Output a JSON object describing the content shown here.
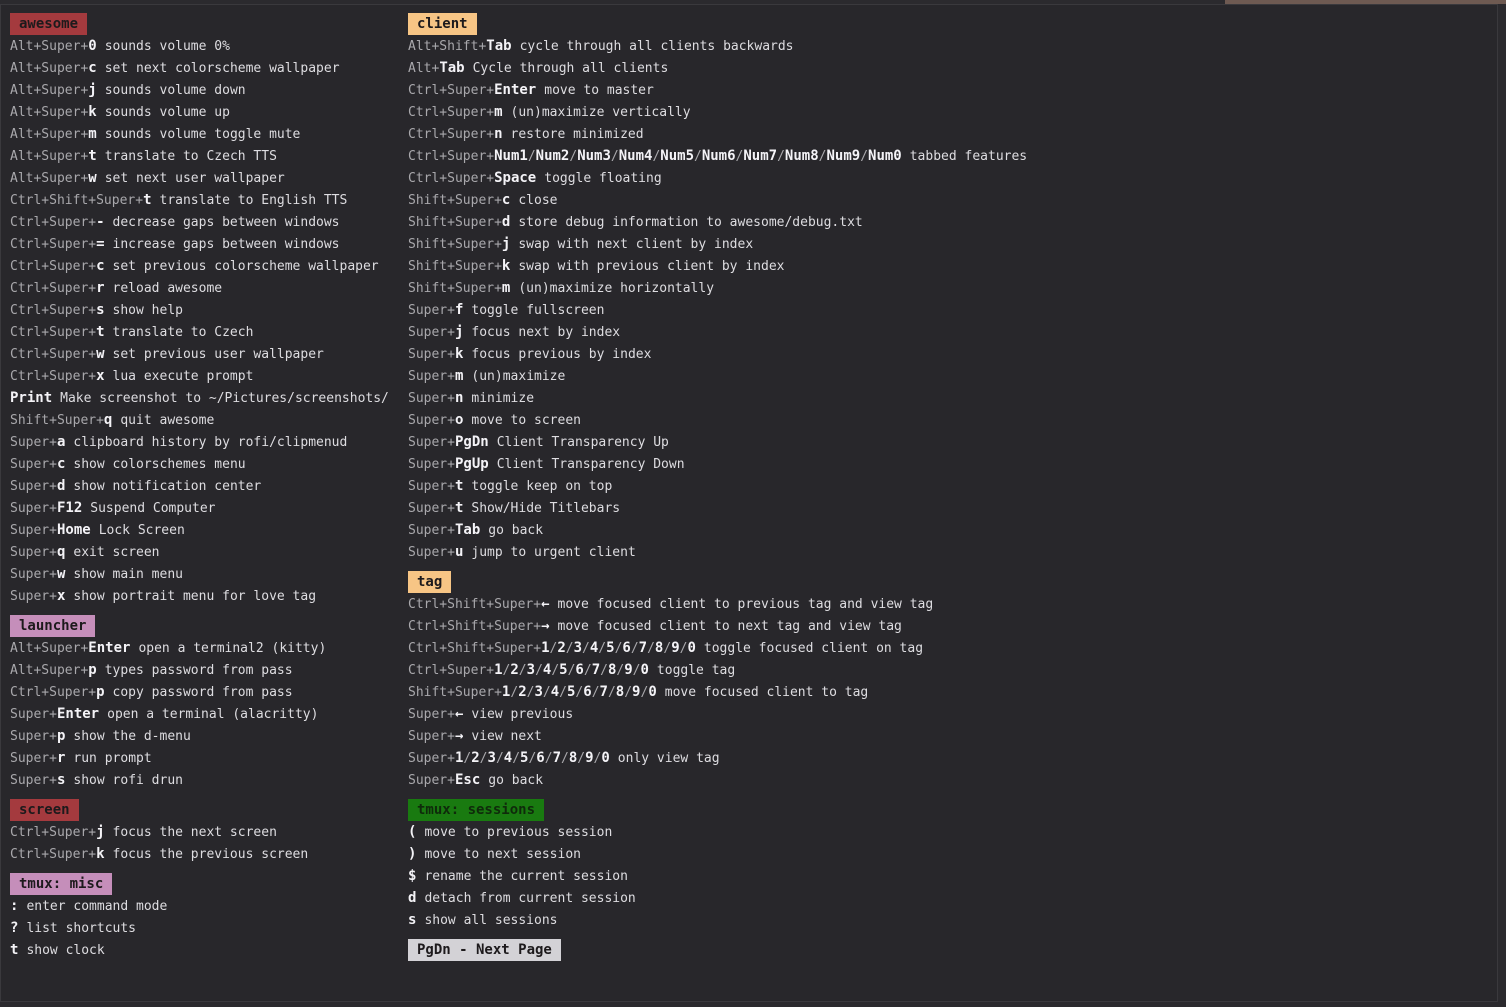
{
  "groups_left": [
    {
      "name": "awesome",
      "color": "red",
      "bindings": [
        {
          "mods": "Alt+Super+",
          "key": "0",
          "desc": "sounds volume 0%"
        },
        {
          "mods": "Alt+Super+",
          "key": "c",
          "desc": "set next colorscheme wallpaper"
        },
        {
          "mods": "Alt+Super+",
          "key": "j",
          "desc": "sounds volume down"
        },
        {
          "mods": "Alt+Super+",
          "key": "k",
          "desc": "sounds volume up"
        },
        {
          "mods": "Alt+Super+",
          "key": "m",
          "desc": "sounds volume toggle mute"
        },
        {
          "mods": "Alt+Super+",
          "key": "t",
          "desc": "translate to Czech TTS"
        },
        {
          "mods": "Alt+Super+",
          "key": "w",
          "desc": "set next user wallpaper"
        },
        {
          "mods": "Ctrl+Shift+Super+",
          "key": "t",
          "desc": "translate to English TTS"
        },
        {
          "mods": "Ctrl+Super+",
          "key": "-",
          "desc": "decrease gaps between windows"
        },
        {
          "mods": "Ctrl+Super+",
          "key": "=",
          "desc": "increase gaps between windows"
        },
        {
          "mods": "Ctrl+Super+",
          "key": "c",
          "desc": "set previous colorscheme wallpaper"
        },
        {
          "mods": "Ctrl+Super+",
          "key": "r",
          "desc": "reload awesome"
        },
        {
          "mods": "Ctrl+Super+",
          "key": "s",
          "desc": "show help"
        },
        {
          "mods": "Ctrl+Super+",
          "key": "t",
          "desc": "translate to Czech"
        },
        {
          "mods": "Ctrl+Super+",
          "key": "w",
          "desc": "set previous user wallpaper"
        },
        {
          "mods": "Ctrl+Super+",
          "key": "x",
          "desc": "lua execute prompt"
        },
        {
          "mods": "",
          "key": "Print",
          "desc": "Make screenshot to ~/Pictures/screenshots/"
        },
        {
          "mods": "Shift+Super+",
          "key": "q",
          "desc": "quit awesome"
        },
        {
          "mods": "Super+",
          "key": "a",
          "desc": "clipboard history by rofi/clipmenud"
        },
        {
          "mods": "Super+",
          "key": "c",
          "desc": "show colorschemes menu"
        },
        {
          "mods": "Super+",
          "key": "d",
          "desc": "show notification center"
        },
        {
          "mods": "Super+",
          "key": "F12",
          "desc": "Suspend Computer"
        },
        {
          "mods": "Super+",
          "key": "Home",
          "desc": "Lock Screen"
        },
        {
          "mods": "Super+",
          "key": "q",
          "desc": "exit screen"
        },
        {
          "mods": "Super+",
          "key": "w",
          "desc": "show main menu"
        },
        {
          "mods": "Super+",
          "key": "x",
          "desc": "show portrait menu for love tag"
        }
      ]
    },
    {
      "name": "launcher",
      "color": "pink",
      "bindings": [
        {
          "mods": "Alt+Super+",
          "key": "Enter",
          "desc": "open a terminal2 (kitty)"
        },
        {
          "mods": "Alt+Super+",
          "key": "p",
          "desc": "types password from pass"
        },
        {
          "mods": "Ctrl+Super+",
          "key": "p",
          "desc": "copy password from pass"
        },
        {
          "mods": "Super+",
          "key": "Enter",
          "desc": "open a terminal (alacritty)"
        },
        {
          "mods": "Super+",
          "key": "p",
          "desc": "show the d-menu"
        },
        {
          "mods": "Super+",
          "key": "r",
          "desc": "run prompt"
        },
        {
          "mods": "Super+",
          "key": "s",
          "desc": "show rofi drun"
        }
      ]
    },
    {
      "name": "screen",
      "color": "red",
      "bindings": [
        {
          "mods": "Ctrl+Super+",
          "key": "j",
          "desc": "focus the next screen"
        },
        {
          "mods": "Ctrl+Super+",
          "key": "k",
          "desc": "focus the previous screen"
        }
      ]
    },
    {
      "name": "tmux: misc",
      "color": "pink",
      "bindings": [
        {
          "mods": "",
          "key": ":",
          "desc": "enter command mode"
        },
        {
          "mods": "",
          "key": "?",
          "desc": "list shortcuts"
        },
        {
          "mods": "",
          "key": "t",
          "desc": "show clock"
        }
      ]
    }
  ],
  "groups_right": [
    {
      "name": "client",
      "color": "orange",
      "bindings": [
        {
          "mods": "Alt+Shift+",
          "key": "Tab",
          "desc": "cycle through all clients backwards"
        },
        {
          "mods": "Alt+",
          "key": "Tab",
          "desc": "Cycle through all clients"
        },
        {
          "mods": "Ctrl+Super+",
          "key": "Enter",
          "desc": "move to master"
        },
        {
          "mods": "Ctrl+Super+",
          "key": "m",
          "desc": "(un)maximize vertically"
        },
        {
          "mods": "Ctrl+Super+",
          "key": "n",
          "desc": "restore minimized"
        },
        {
          "mods": "Ctrl+Super+",
          "keys": [
            "Num1",
            "Num2",
            "Num3",
            "Num4",
            "Num5",
            "Num6",
            "Num7",
            "Num8",
            "Num9",
            "Num0"
          ],
          "desc": "tabbed features"
        },
        {
          "mods": "Ctrl+Super+",
          "key": "Space",
          "desc": "toggle floating"
        },
        {
          "mods": "Shift+Super+",
          "key": "c",
          "desc": "close"
        },
        {
          "mods": "Shift+Super+",
          "key": "d",
          "desc": "store debug information to awesome/debug.txt"
        },
        {
          "mods": "Shift+Super+",
          "key": "j",
          "desc": "swap with next client by index"
        },
        {
          "mods": "Shift+Super+",
          "key": "k",
          "desc": "swap with previous client by index"
        },
        {
          "mods": "Shift+Super+",
          "key": "m",
          "desc": "(un)maximize horizontally"
        },
        {
          "mods": "Super+",
          "key": "f",
          "desc": "toggle fullscreen"
        },
        {
          "mods": "Super+",
          "key": "j",
          "desc": "focus next by index"
        },
        {
          "mods": "Super+",
          "key": "k",
          "desc": "focus previous by index"
        },
        {
          "mods": "Super+",
          "key": "m",
          "desc": "(un)maximize"
        },
        {
          "mods": "Super+",
          "key": "n",
          "desc": "minimize"
        },
        {
          "mods": "Super+",
          "key": "o",
          "desc": "move to screen"
        },
        {
          "mods": "Super+",
          "key": "PgDn",
          "desc": "Client Transparency Up"
        },
        {
          "mods": "Super+",
          "key": "PgUp",
          "desc": "Client Transparency Down"
        },
        {
          "mods": "Super+",
          "key": "t",
          "desc": "toggle keep on top"
        },
        {
          "mods": "Super+",
          "key": "t",
          "desc": "Show/Hide Titlebars"
        },
        {
          "mods": "Super+",
          "key": "Tab",
          "desc": "go back"
        },
        {
          "mods": "Super+",
          "key": "u",
          "desc": "jump to urgent client"
        }
      ]
    },
    {
      "name": "tag",
      "color": "orange",
      "bindings": [
        {
          "mods": "Ctrl+Shift+Super+",
          "key": "←",
          "desc": "move focused client to previous tag and view tag"
        },
        {
          "mods": "Ctrl+Shift+Super+",
          "key": "→",
          "desc": "move focused client to next tag and view tag"
        },
        {
          "mods": "Ctrl+Shift+Super+",
          "keys": [
            "1",
            "2",
            "3",
            "4",
            "5",
            "6",
            "7",
            "8",
            "9",
            "0"
          ],
          "desc": "toggle focused client on tag"
        },
        {
          "mods": "Ctrl+Super+",
          "keys": [
            "1",
            "2",
            "3",
            "4",
            "5",
            "6",
            "7",
            "8",
            "9",
            "0"
          ],
          "desc": "toggle tag"
        },
        {
          "mods": "Shift+Super+",
          "keys": [
            "1",
            "2",
            "3",
            "4",
            "5",
            "6",
            "7",
            "8",
            "9",
            "0"
          ],
          "desc": "move focused client to tag"
        },
        {
          "mods": "Super+",
          "key": "←",
          "desc": "view previous"
        },
        {
          "mods": "Super+",
          "key": "→",
          "desc": "view next"
        },
        {
          "mods": "Super+",
          "keys": [
            "1",
            "2",
            "3",
            "4",
            "5",
            "6",
            "7",
            "8",
            "9",
            "0"
          ],
          "desc": "only view tag"
        },
        {
          "mods": "Super+",
          "key": "Esc",
          "desc": "go back"
        }
      ]
    },
    {
      "name": "tmux: sessions",
      "color": "green",
      "bindings": [
        {
          "mods": "",
          "key": "(",
          "desc": "move to previous session"
        },
        {
          "mods": "",
          "key": ")",
          "desc": "move to next session"
        },
        {
          "mods": "",
          "key": "$",
          "desc": "rename the current session"
        },
        {
          "mods": "",
          "key": "d",
          "desc": "detach from current session"
        },
        {
          "mods": "",
          "key": "s",
          "desc": "show all sessions"
        }
      ]
    }
  ],
  "footer": {
    "label": "PgDn - Next Page",
    "color": "gray"
  }
}
